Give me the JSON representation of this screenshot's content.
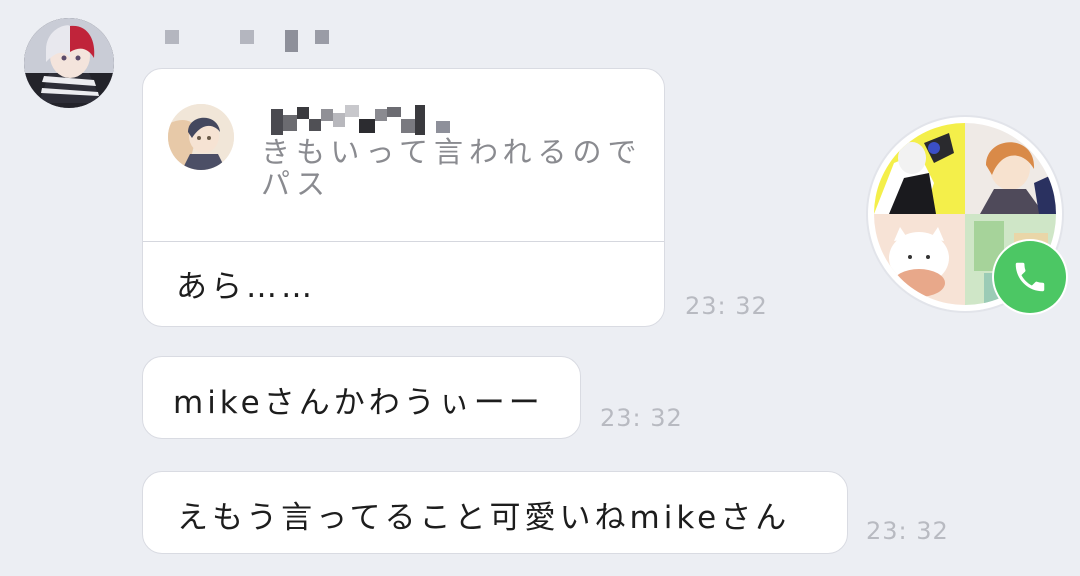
{
  "chat": {
    "sender": {
      "name_redacted": true
    },
    "messages": [
      {
        "type": "reply",
        "quoted": {
          "author_redacted": true,
          "text": "きもいって言われるのでパス"
        },
        "text": "あら……",
        "time": "23: 32"
      },
      {
        "type": "text",
        "text": "mikeさんかわうぃーー",
        "time": "23: 32"
      },
      {
        "type": "text",
        "text": "えもう言ってること可愛いねmikeさん",
        "time": "23: 32"
      }
    ]
  },
  "colors": {
    "background": "#eceef3",
    "bubble": "#ffffff",
    "timestamp": "#b8bac1",
    "call_green": "#4cc764"
  },
  "icons": {
    "call": "phone-icon"
  }
}
